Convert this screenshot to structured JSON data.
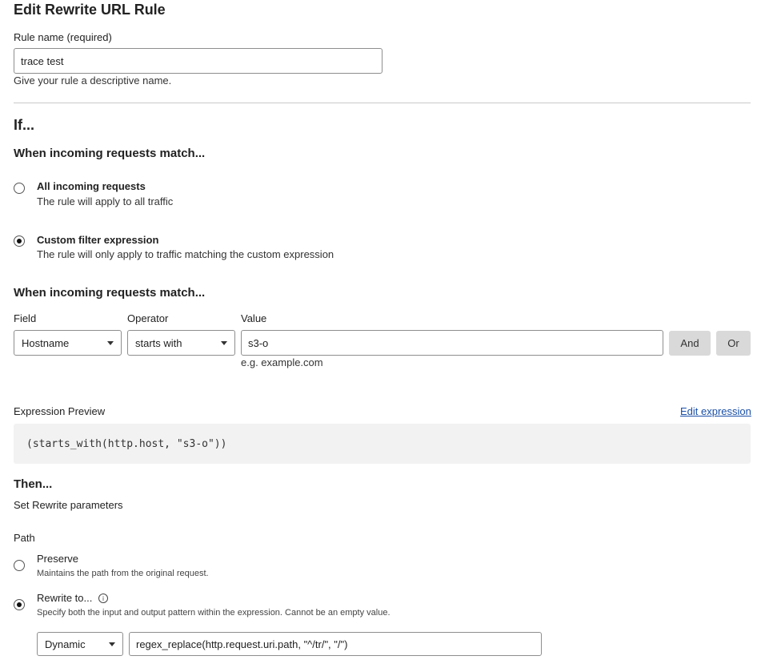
{
  "page": {
    "title": "Edit Rewrite URL Rule"
  },
  "rule_name": {
    "label": "Rule name (required)",
    "value": "trace test",
    "help": "Give your rule a descriptive name."
  },
  "if_section": {
    "heading": "If...",
    "match_heading": "When incoming requests match...",
    "options": [
      {
        "title": "All incoming requests",
        "desc": "The rule will apply to all traffic",
        "selected": false
      },
      {
        "title": "Custom filter expression",
        "desc": "The rule will only apply to traffic matching the custom expression",
        "selected": true
      }
    ]
  },
  "filter": {
    "heading": "When incoming requests match...",
    "field_label": "Field",
    "field_value": "Hostname",
    "operator_label": "Operator",
    "operator_value": "starts with",
    "value_label": "Value",
    "value_value": "s3-o",
    "value_hint": "e.g. example.com",
    "and_label": "And",
    "or_label": "Or"
  },
  "expression": {
    "label": "Expression Preview",
    "edit_link": "Edit expression",
    "code": "(starts_with(http.host, \"s3-o\"))"
  },
  "then_section": {
    "heading": "Then...",
    "subheading": "Set Rewrite parameters",
    "path_label": "Path",
    "options": [
      {
        "title": "Preserve",
        "desc": "Maintains the path from the original request.",
        "selected": false
      },
      {
        "title": "Rewrite to...",
        "desc": "Specify both the input and output pattern within the expression. Cannot be an empty value.",
        "selected": true
      }
    ],
    "info_glyph": "i",
    "rewrite_type": "Dynamic",
    "rewrite_expression": "regex_replace(http.request.uri.path, \"^/tr/\", \"/\")"
  }
}
